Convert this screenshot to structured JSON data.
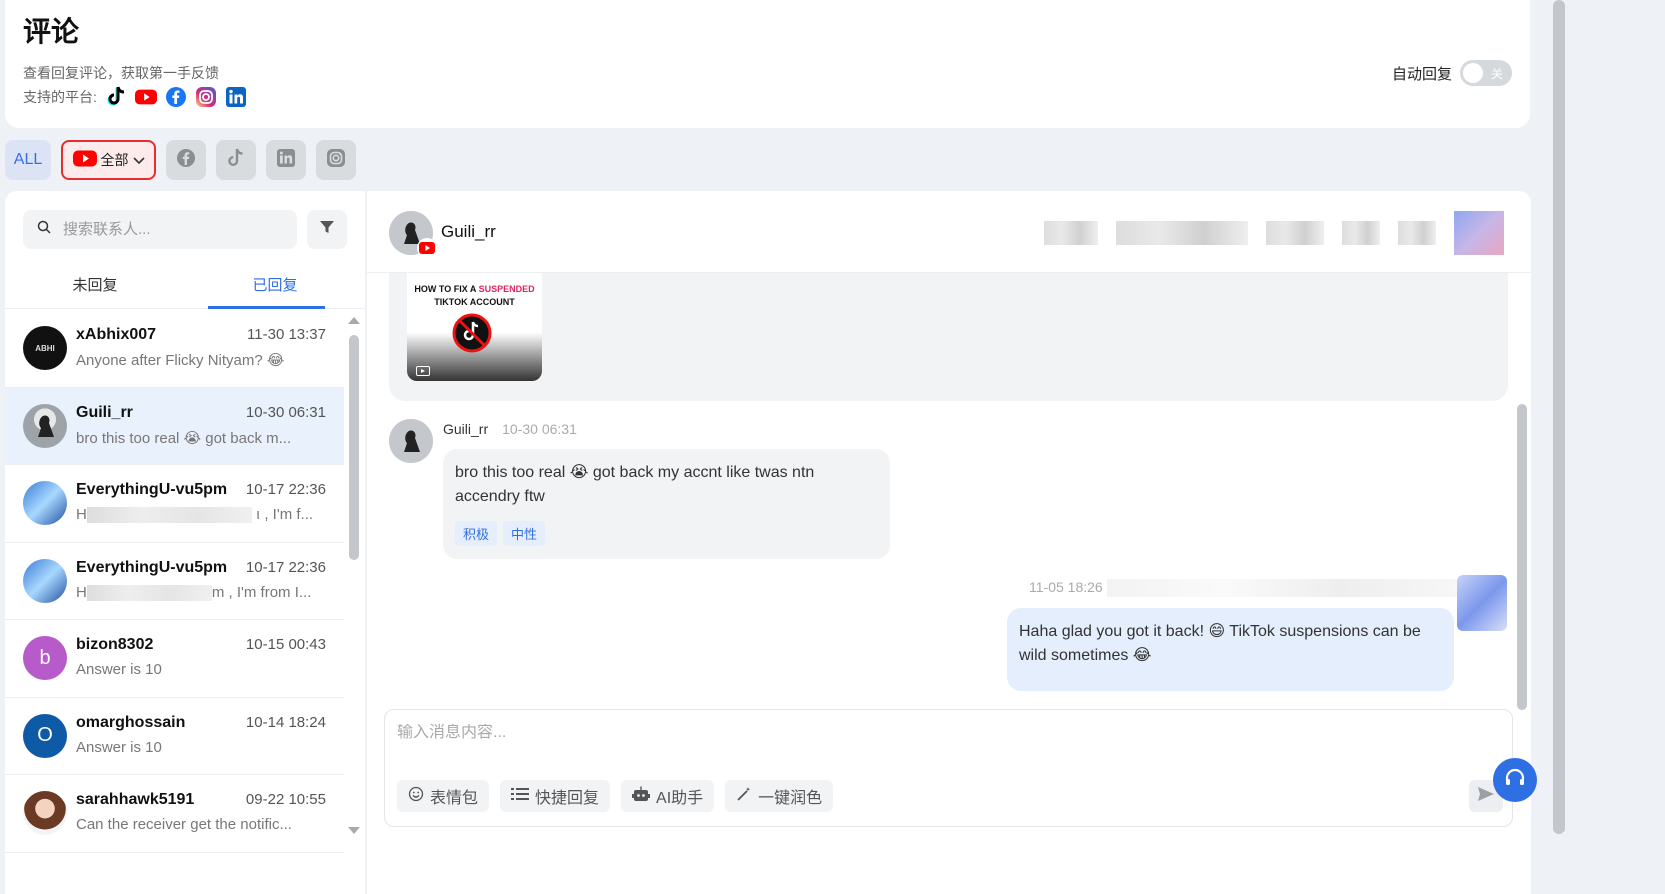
{
  "header": {
    "title": "评论",
    "subtitle": "查看回复评论，获取第一手反馈",
    "platforms_label": "支持的平台:",
    "platform_icons": [
      "tiktok-icon",
      "youtube-icon",
      "facebook-icon",
      "instagram-icon",
      "linkedin-icon"
    ],
    "auto_reply_label": "自动回复",
    "auto_reply_toggle_text": "关"
  },
  "filters": {
    "all_label": "ALL",
    "youtube_label": "全部"
  },
  "sidebar": {
    "search_placeholder": "搜索联系人...",
    "tabs": [
      {
        "label": "未回复"
      },
      {
        "label": "已回复"
      }
    ],
    "contacts": [
      {
        "name": "xAbhix007",
        "time": "11-30 13:37",
        "msg": "Anyone after Flicky Nityam? 😂",
        "avatar_text": "ABHI"
      },
      {
        "name": "Guili_rr",
        "time": "10-30 06:31",
        "msg": "bro this too real 😭 got back m...",
        "avatar_text": ""
      },
      {
        "name": "EverythingU-vu5pm",
        "time": "10-17 22:36",
        "msg_prefix": "H",
        "msg_suffix": "ı , I'm f...",
        "avatar_text": ""
      },
      {
        "name": "EverythingU-vu5pm",
        "time": "10-17 22:36",
        "msg_prefix": "H",
        "msg_suffix": "m , I'm from I...",
        "avatar_text": ""
      },
      {
        "name": "bizon8302",
        "time": "10-15 00:43",
        "msg": "Answer is 10",
        "avatar_text": "b"
      },
      {
        "name": "omarghossain",
        "time": "10-14 18:24",
        "msg": "Answer is 10",
        "avatar_text": "O"
      },
      {
        "name": "sarahhawk5191",
        "time": "09-22 10:55",
        "msg": "Can the receiver get the notific...",
        "avatar_text": ""
      }
    ]
  },
  "chat": {
    "contact_name": "Guili_rr",
    "post_thumbnail": {
      "line1_a": "HOW TO FIX A ",
      "line1_b": "SUSPENDED",
      "line2": "TIKTOK ACCOUNT"
    },
    "incoming": {
      "author": "Guili_rr",
      "time": "10-30 06:31",
      "text": "bro this too real 😭 got back my accnt like twas ntn accendry ftw",
      "tags": [
        "积极",
        "中性"
      ]
    },
    "outgoing": {
      "time": "11-05 18:26",
      "text": "Haha glad you got it back! 😄 TikTok suspensions can be wild sometimes 😂"
    }
  },
  "composer": {
    "placeholder": "输入消息内容...",
    "tools": [
      {
        "icon": "emoji-icon",
        "label": "表情包"
      },
      {
        "icon": "list-icon",
        "label": "快捷回复"
      },
      {
        "icon": "robot-icon",
        "label": "AI助手"
      },
      {
        "icon": "magic-wand-icon",
        "label": "一键润色"
      }
    ]
  },
  "colors": {
    "accent": "#2f6fe4",
    "youtube_red": "#e62e2e",
    "selected_row": "#e9f1fc"
  }
}
